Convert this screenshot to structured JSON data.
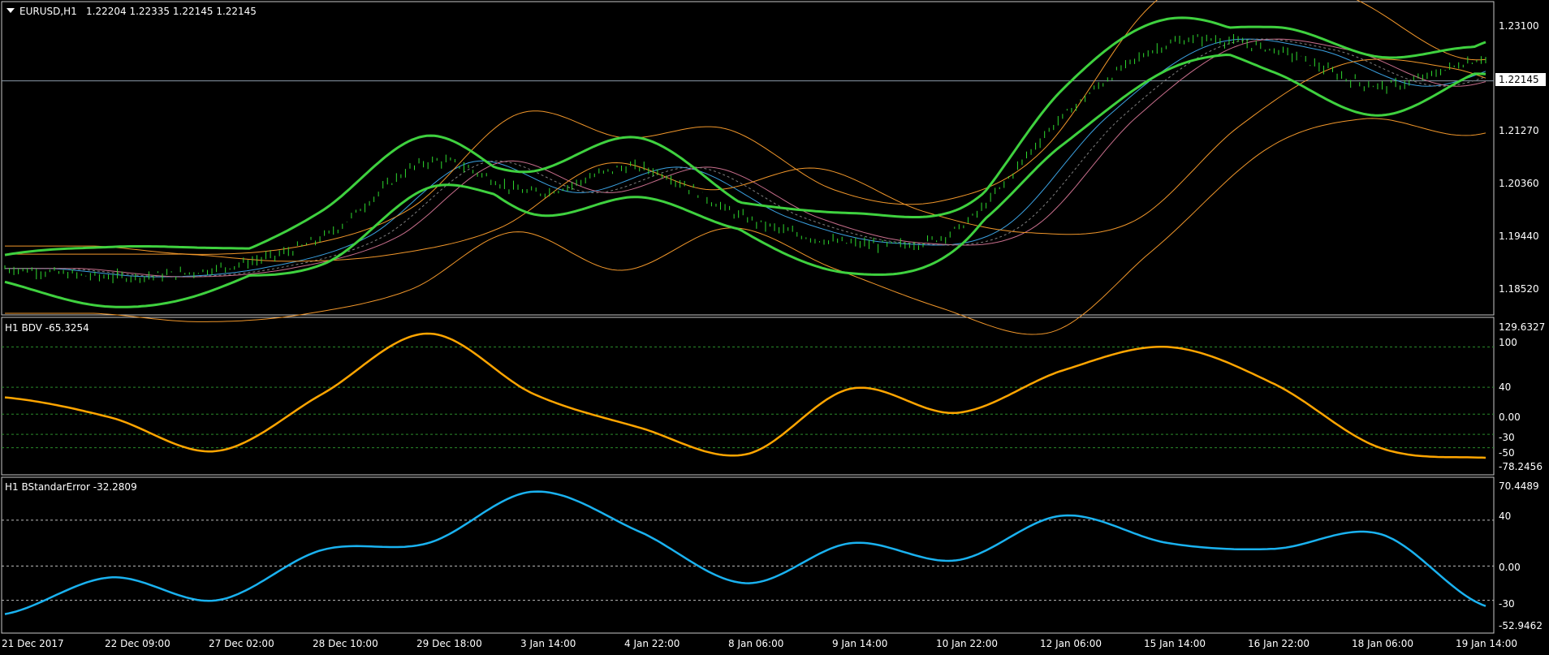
{
  "window": {
    "symbol_info": "EURUSD,H1",
    "ohlc": "1.22204 1.22335 1.22145 1.22145",
    "current_price": "1.22145",
    "price_ticks": [
      "1.23100",
      "1.21270",
      "1.20360",
      "1.19440",
      "1.18520"
    ],
    "time_labels": [
      "21 Dec 2017",
      "22 Dec 09:00",
      "27 Dec 02:00",
      "28 Dec 10:00",
      "29 Dec 18:00",
      "3 Jan 14:00",
      "4 Jan 22:00",
      "8 Jan 06:00",
      "9 Jan 14:00",
      "10 Jan 22:00",
      "12 Jan 06:00",
      "15 Jan 14:00",
      "16 Jan 22:00",
      "18 Jan 06:00",
      "19 Jan 14:00"
    ]
  },
  "bdv": {
    "label": "H1 BDV -65.3254",
    "axis_labels": [
      "129.6327",
      "100",
      "40",
      "0.00",
      "-30",
      "-50",
      "-78.2456"
    ],
    "color": "#ffa500"
  },
  "se": {
    "label": "H1 BStandarError -32.2809",
    "axis_labels": [
      "70.4489",
      "40",
      "0.00",
      "-30",
      "-52.9462"
    ],
    "color": "#1ab2f0"
  },
  "colors": {
    "bands": "#3fd13f",
    "candles": "#2ed82e",
    "orange": "#f0962a",
    "blue": "#3aa0e0",
    "pink": "#c86e8c",
    "grid": "#2a8a2a"
  },
  "chart_data": [
    {
      "type": "line",
      "title": "EURUSD,H1",
      "ylim": [
        1.18,
        1.235
      ],
      "x": [
        "21 Dec 2017",
        "22 Dec 09:00",
        "27 Dec 02:00",
        "28 Dec 10:00",
        "29 Dec 18:00",
        "3 Jan 14:00",
        "4 Jan 22:00",
        "8 Jan 06:00",
        "9 Jan 14:00",
        "10 Jan 22:00",
        "12 Jan 06:00",
        "15 Jan 14:00",
        "16 Jan 22:00",
        "18 Jan 06:00",
        "19 Jan 14:00"
      ],
      "series": [
        {
          "values": [
            1.188,
            1.1865,
            1.188,
            1.1935,
            1.207,
            1.2015,
            1.206,
            1.197,
            1.1925,
            1.195,
            1.215,
            1.228,
            1.227,
            1.2205,
            1.2255
          ]
        }
      ]
    },
    {
      "type": "line",
      "title": "H1 BDV -65.3254",
      "ylim": [
        -78.2456,
        129.6327
      ],
      "y_ticks": [
        100,
        40,
        0,
        -30,
        -50
      ],
      "x": [
        "21 Dec 2017",
        "22 Dec 09:00",
        "27 Dec 02:00",
        "28 Dec 10:00",
        "29 Dec 18:00",
        "3 Jan 14:00",
        "4 Jan 22:00",
        "8 Jan 06:00",
        "9 Jan 14:00",
        "10 Jan 22:00",
        "12 Jan 06:00",
        "15 Jan 14:00",
        "16 Jan 22:00",
        "18 Jan 06:00",
        "19 Jan 14:00"
      ],
      "series": [
        {
          "values": [
            25,
            -5,
            -55,
            30,
            120,
            30,
            -20,
            -60,
            38,
            2,
            65,
            100,
            45,
            -50,
            -65
          ]
        }
      ]
    },
    {
      "type": "line",
      "title": "H1 BStandarError -32.2809",
      "ylim": [
        -52.9462,
        70.4489
      ],
      "y_ticks": [
        40,
        0,
        -30
      ],
      "x": [
        "21 Dec 2017",
        "22 Dec 09:00",
        "27 Dec 02:00",
        "28 Dec 10:00",
        "29 Dec 18:00",
        "3 Jan 14:00",
        "4 Jan 22:00",
        "8 Jan 06:00",
        "9 Jan 14:00",
        "10 Jan 22:00",
        "12 Jan 06:00",
        "15 Jan 14:00",
        "16 Jan 22:00",
        "18 Jan 06:00",
        "19 Jan 14:00"
      ],
      "series": [
        {
          "values": [
            -42,
            -10,
            -30,
            14,
            20,
            65,
            30,
            -15,
            20,
            5,
            44,
            20,
            15,
            28,
            -35
          ]
        }
      ]
    }
  ]
}
